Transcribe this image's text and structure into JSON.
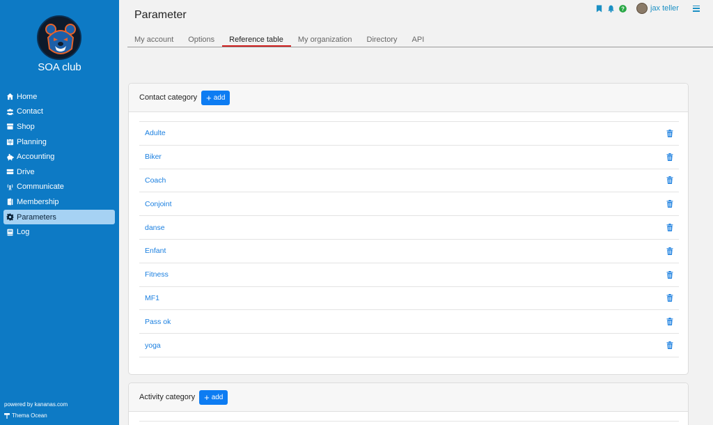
{
  "sidebar": {
    "club_name": "SOA club",
    "items": [
      {
        "label": "Home",
        "icon": "home-icon"
      },
      {
        "label": "Contact",
        "icon": "users-icon"
      },
      {
        "label": "Shop",
        "icon": "store-icon"
      },
      {
        "label": "Planning",
        "icon": "calendar-icon"
      },
      {
        "label": "Accounting",
        "icon": "piggy-bank-icon"
      },
      {
        "label": "Drive",
        "icon": "drive-icon"
      },
      {
        "label": "Communicate",
        "icon": "broadcast-icon"
      },
      {
        "label": "Membership",
        "icon": "door-icon"
      },
      {
        "label": "Parameters",
        "icon": "gear-icon"
      },
      {
        "label": "Log",
        "icon": "book-icon"
      }
    ],
    "active_index": 8,
    "powered_by": "powered by kananas.com",
    "theme": "Thema Ocean"
  },
  "header": {
    "title": "Parameter",
    "user_name": "jax teller",
    "help_glyph": "?"
  },
  "tabs": [
    {
      "label": "My account",
      "active": false
    },
    {
      "label": "Options",
      "active": false
    },
    {
      "label": "Reference table",
      "active": true
    },
    {
      "label": "My organization",
      "active": false
    },
    {
      "label": "Directory",
      "active": false
    },
    {
      "label": "API",
      "active": false
    }
  ],
  "contact_category": {
    "title": "Contact category",
    "add_label": "add",
    "items": [
      "Adulte",
      "Biker",
      "Coach",
      "Conjoint",
      "danse",
      "Enfant",
      "Fitness",
      "MF1",
      "Pass ok",
      "yoga"
    ]
  },
  "activity_category": {
    "title": "Activity category",
    "add_label": "add"
  },
  "colors": {
    "sidebar": "#0d7ac5",
    "accent": "#0d7cf2",
    "link": "#1a7fe0",
    "active_tab_underline": "#d0201f",
    "help_badge": "#28a745"
  }
}
